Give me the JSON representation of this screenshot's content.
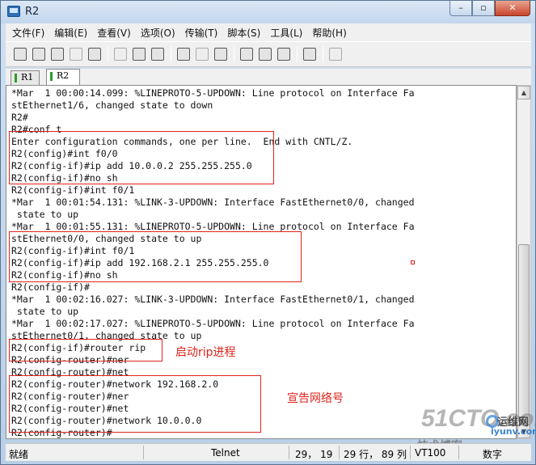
{
  "window": {
    "title": "R2"
  },
  "menu": [
    "文件(F)",
    "编辑(E)",
    "查看(V)",
    "选项(O)",
    "传输(T)",
    "脚本(S)",
    "工具(L)",
    "帮助(H)"
  ],
  "toolbar_icons": [
    "connect-icon",
    "quick-connect-icon",
    "connect-in-tab-icon",
    "reconnect-icon",
    "disconnect-icon",
    "copy-icon",
    "paste-icon",
    "find-icon",
    "print-icon",
    "print-setup-icon",
    "print-selection-icon",
    "session-options-icon",
    "global-options-icon",
    "keymap-icon",
    "help-icon",
    "log-icon"
  ],
  "tabs": [
    {
      "label": "R1"
    },
    {
      "label": "R2"
    }
  ],
  "terminal_lines": [
    "*Mar  1 00:00:14.099: %LINEPROTO-5-UPDOWN: Line protocol on Interface Fa",
    "stEthernet1/6, changed state to down",
    "R2#",
    "R2#conf t",
    "Enter configuration commands, one per line.  End with CNTL/Z.",
    "R2(config)#int f0/0",
    "R2(config-if)#ip add 10.0.0.2 255.255.255.0",
    "R2(config-if)#no sh",
    "R2(config-if)#int f0/1",
    "*Mar  1 00:01:54.131: %LINK-3-UPDOWN: Interface FastEthernet0/0, changed",
    " state to up",
    "*Mar  1 00:01:55.131: %LINEPROTO-5-UPDOWN: Line protocol on Interface Fa",
    "stEthernet0/0, changed state to up",
    "R2(config-if)#int f0/1",
    "R2(config-if)#ip add 192.168.2.1 255.255.255.0",
    "R2(config-if)#no sh",
    "R2(config-if)#",
    "*Mar  1 00:02:16.027: %LINK-3-UPDOWN: Interface FastEthernet0/1, changed",
    " state to up",
    "*Mar  1 00:02:17.027: %LINEPROTO-5-UPDOWN: Line protocol on Interface Fa",
    "stEthernet0/1, changed state to up",
    "R2(config-if)#router rip",
    "R2(config-router)#ner",
    "R2(config-router)#net",
    "R2(config-router)#network 192.168.2.0",
    "R2(config-router)#ner",
    "R2(config-router)#net",
    "R2(config-router)#network 10.0.0.0",
    "R2(config-router)#"
  ],
  "annotations": {
    "start_rip": "启动rip进程",
    "announce_networks": "宣告网络号"
  },
  "watermark": {
    "brand": "51CTO.com",
    "tagline": "技术博客",
    "logo_text": "运维网",
    "logo_url": "iyunv.com"
  },
  "status": {
    "ready": "就绪",
    "protocol": "Telnet",
    "cursor": "29， 19",
    "rows_cols": "29 行， 89 列",
    "terminal": "VT100",
    "caps": "数字"
  }
}
